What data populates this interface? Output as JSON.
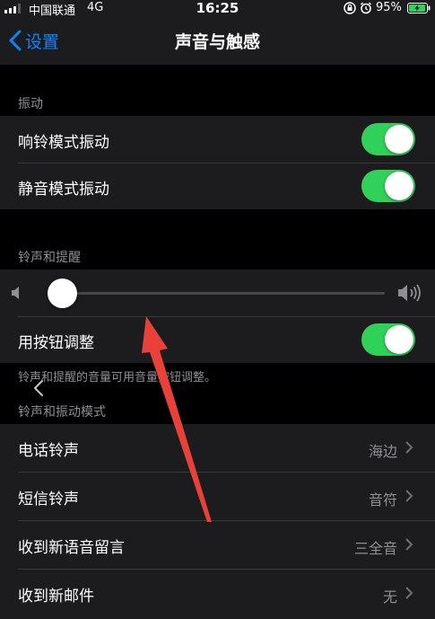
{
  "status_bar": {
    "carrier": "中国联通",
    "network": "4G",
    "time": "16:25",
    "battery": "95%",
    "signal_bars_active": 3,
    "signal_bars_total": 4,
    "battery_level": 0.95,
    "battery_color": "#30d158"
  },
  "nav": {
    "back_label": "设置",
    "title": "声音与触感",
    "accent_color": "#0a84ff"
  },
  "vibration": {
    "header": "振动",
    "rows": [
      {
        "label": "响铃模式振动",
        "on": true
      },
      {
        "label": "静音模式振动",
        "on": true
      }
    ]
  },
  "ringer": {
    "header": "铃声和提醒",
    "volume_level": 0,
    "change_with_buttons": {
      "label": "用按钮调整",
      "on": true
    },
    "footnote": "铃声和提醒的音量可用音量按钮调整。"
  },
  "patterns": {
    "header": "铃声和振动模式",
    "rows": [
      {
        "label": "电话铃声",
        "value": "海边"
      },
      {
        "label": "短信铃声",
        "value": "音符"
      },
      {
        "label": "收到新语音留言",
        "value": "三全音"
      },
      {
        "label": "收到新邮件",
        "value": "无"
      }
    ]
  },
  "toggle_on_color": "#30d158",
  "annotation_arrow_color": "#e8413a"
}
